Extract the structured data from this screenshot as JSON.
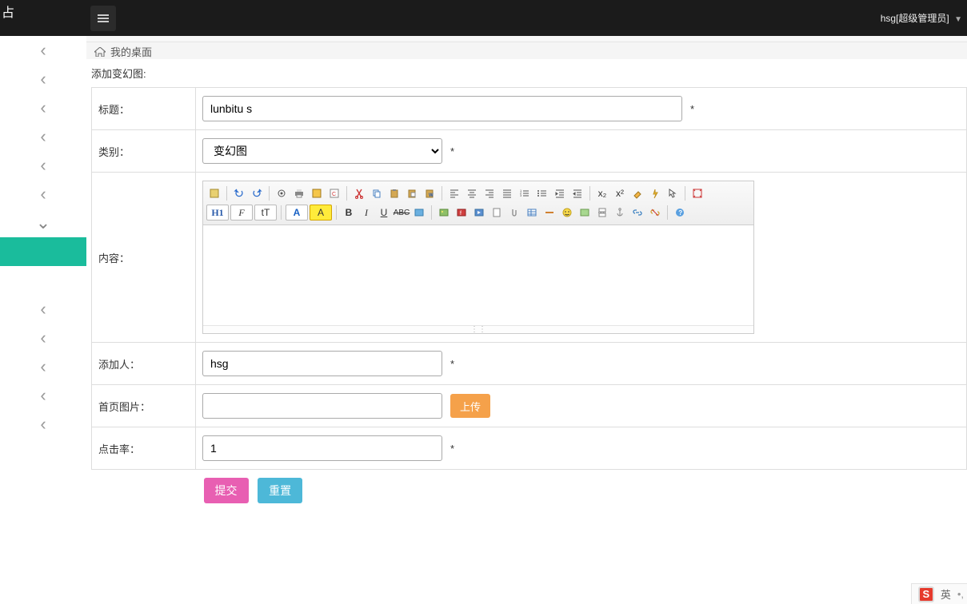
{
  "topbar": {
    "brand_fragment": "占",
    "user_label": "hsg[超级管理员]"
  },
  "breadcrumb": {
    "home_label": "我的桌面"
  },
  "page": {
    "title": "添加变幻图:"
  },
  "fields": {
    "title": {
      "label": "标题：",
      "value": "lunbitu s",
      "required": "*"
    },
    "category": {
      "label": "类别：",
      "selected": "变幻图",
      "required": "*"
    },
    "content": {
      "label": "内容："
    },
    "author": {
      "label": "添加人：",
      "value": "hsg",
      "required": "*"
    },
    "image": {
      "label": "首页图片：",
      "value": "",
      "upload_label": "上传"
    },
    "hits": {
      "label": "点击率：",
      "value": "1",
      "required": "*"
    }
  },
  "actions": {
    "submit": "提交",
    "reset": "重置"
  },
  "editor_toolbar": {
    "row1": [
      "source",
      "undo",
      "redo",
      "sep",
      "preview",
      "print",
      "template",
      "code",
      "sep",
      "cut",
      "copy",
      "paste",
      "paste-text",
      "paste-word",
      "sep",
      "align-left",
      "align-center",
      "align-right",
      "justify",
      "indent",
      "outdent",
      "ol",
      "ul",
      "sep",
      "sub",
      "sup",
      "eraser",
      "quick",
      "select-all",
      "sep",
      "fullscreen"
    ],
    "row2": [
      "heading",
      "font-family",
      "font-size",
      "sep",
      "font-color",
      "hilite",
      "sep",
      "bold",
      "italic",
      "underline",
      "strike",
      "format",
      "sep",
      "image",
      "flash",
      "media",
      "file",
      "attach",
      "table",
      "hr",
      "emoji",
      "map",
      "pagebreak",
      "anchor",
      "link",
      "unlink",
      "sep",
      "about"
    ],
    "heading_text": "H1",
    "font_family_text": "F",
    "font_size_text": "tT",
    "font_color_text": "A",
    "hilite_text": "A",
    "bold_text": "B",
    "italic_text": "I",
    "underline_text": "U",
    "strike_text": "ABC",
    "sub_text": "x₂",
    "sup_text": "x²"
  },
  "ime": {
    "sogou": "S",
    "lang": "英",
    "punct": "•,",
    "extra": ""
  }
}
